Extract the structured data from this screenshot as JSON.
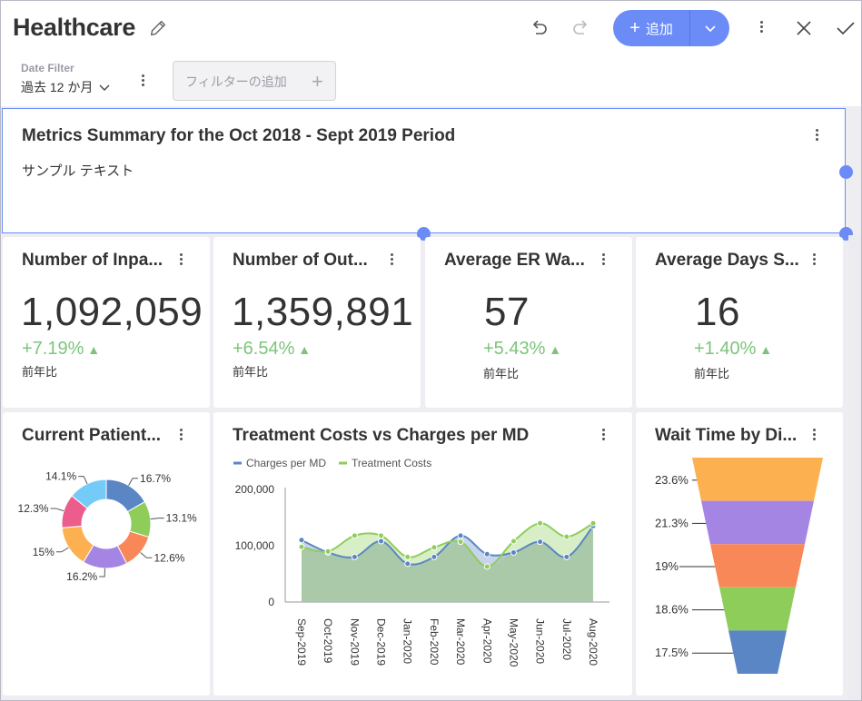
{
  "header": {
    "title": "Healthcare",
    "add_label": "追加"
  },
  "filters": {
    "date_label": "Date Filter",
    "date_value": "過去 12 か月",
    "add_filter_placeholder": "フィルターの追加"
  },
  "summary": {
    "title": "Metrics Summary for the Oct 2018 - Sept 2019 Period",
    "text": "サンプル テキスト"
  },
  "kpis": [
    {
      "title": "Number of Inpa...",
      "value": "1,092,059",
      "change": "+7.19%",
      "sub": "前年比"
    },
    {
      "title": "Number of Out...",
      "value": "1,359,891",
      "change": "+6.54%",
      "sub": "前年比"
    },
    {
      "title": "Average ER Wa...",
      "value": "57",
      "change": "+5.43%",
      "sub": "前年比"
    },
    {
      "title": "Average Days S...",
      "value": "16",
      "change": "+1.40%",
      "sub": "前年比"
    }
  ],
  "colors": {
    "accent": "#6b8cf7",
    "positive": "#7cc47a"
  },
  "icons": {
    "edit": "pencil-icon",
    "undo": "undo-icon",
    "redo": "redo-icon",
    "more": "kebab-icon",
    "close": "close-icon",
    "confirm": "check-icon",
    "trend_up": "triangle-up-icon"
  },
  "chart_data": [
    {
      "type": "pie",
      "title": "Current Patient...",
      "categories": [
        "",
        "",
        "",
        "",
        "",
        ""
      ],
      "values": [
        16.7,
        13.1,
        12.6,
        16.2,
        15,
        12.3,
        14.1
      ],
      "labels": [
        "16.7%",
        "13.1%",
        "12.6%",
        "16.2%",
        "15%",
        "12.3%",
        "14.1%"
      ],
      "colors": [
        "#5b86c5",
        "#8fcd5b",
        "#f98858",
        "#a485e3",
        "#fdb050",
        "#ec5c8c",
        "#74cbf8"
      ],
      "donut": true
    },
    {
      "type": "area",
      "title": "Treatment Costs vs Charges per MD",
      "x": [
        "Sep-2019",
        "Oct-2019",
        "Nov-2019",
        "Dec-2019",
        "Jan-2020",
        "Feb-2020",
        "Mar-2020",
        "Apr-2020",
        "May-2020",
        "Jun-2020",
        "Jul-2020",
        "Aug-2020"
      ],
      "series": [
        {
          "name": "Charges per MD",
          "color": "#5b86c5",
          "values": [
            110000,
            88000,
            80000,
            108000,
            68000,
            80000,
            118000,
            85000,
            88000,
            107000,
            80000,
            135000
          ]
        },
        {
          "name": "Treatment Costs",
          "color": "#8fcd5b",
          "values": [
            98000,
            90000,
            118000,
            118000,
            80000,
            97000,
            107000,
            63000,
            108000,
            140000,
            116000,
            140000
          ]
        }
      ],
      "yticks": [
        "200,000",
        "100,000",
        "0"
      ],
      "ylim": [
        0,
        200000
      ],
      "legend": "top-left",
      "grid": false
    },
    {
      "type": "funnel",
      "title": "Wait Time by Di...",
      "labels": [
        "23.6%",
        "21.3%",
        "19%",
        "18.6%",
        "17.5%"
      ],
      "values": [
        23.6,
        21.3,
        19,
        18.6,
        17.5
      ],
      "colors": [
        "#fdb050",
        "#a485e3",
        "#f98858",
        "#8fcd5b",
        "#5b86c5"
      ]
    }
  ]
}
